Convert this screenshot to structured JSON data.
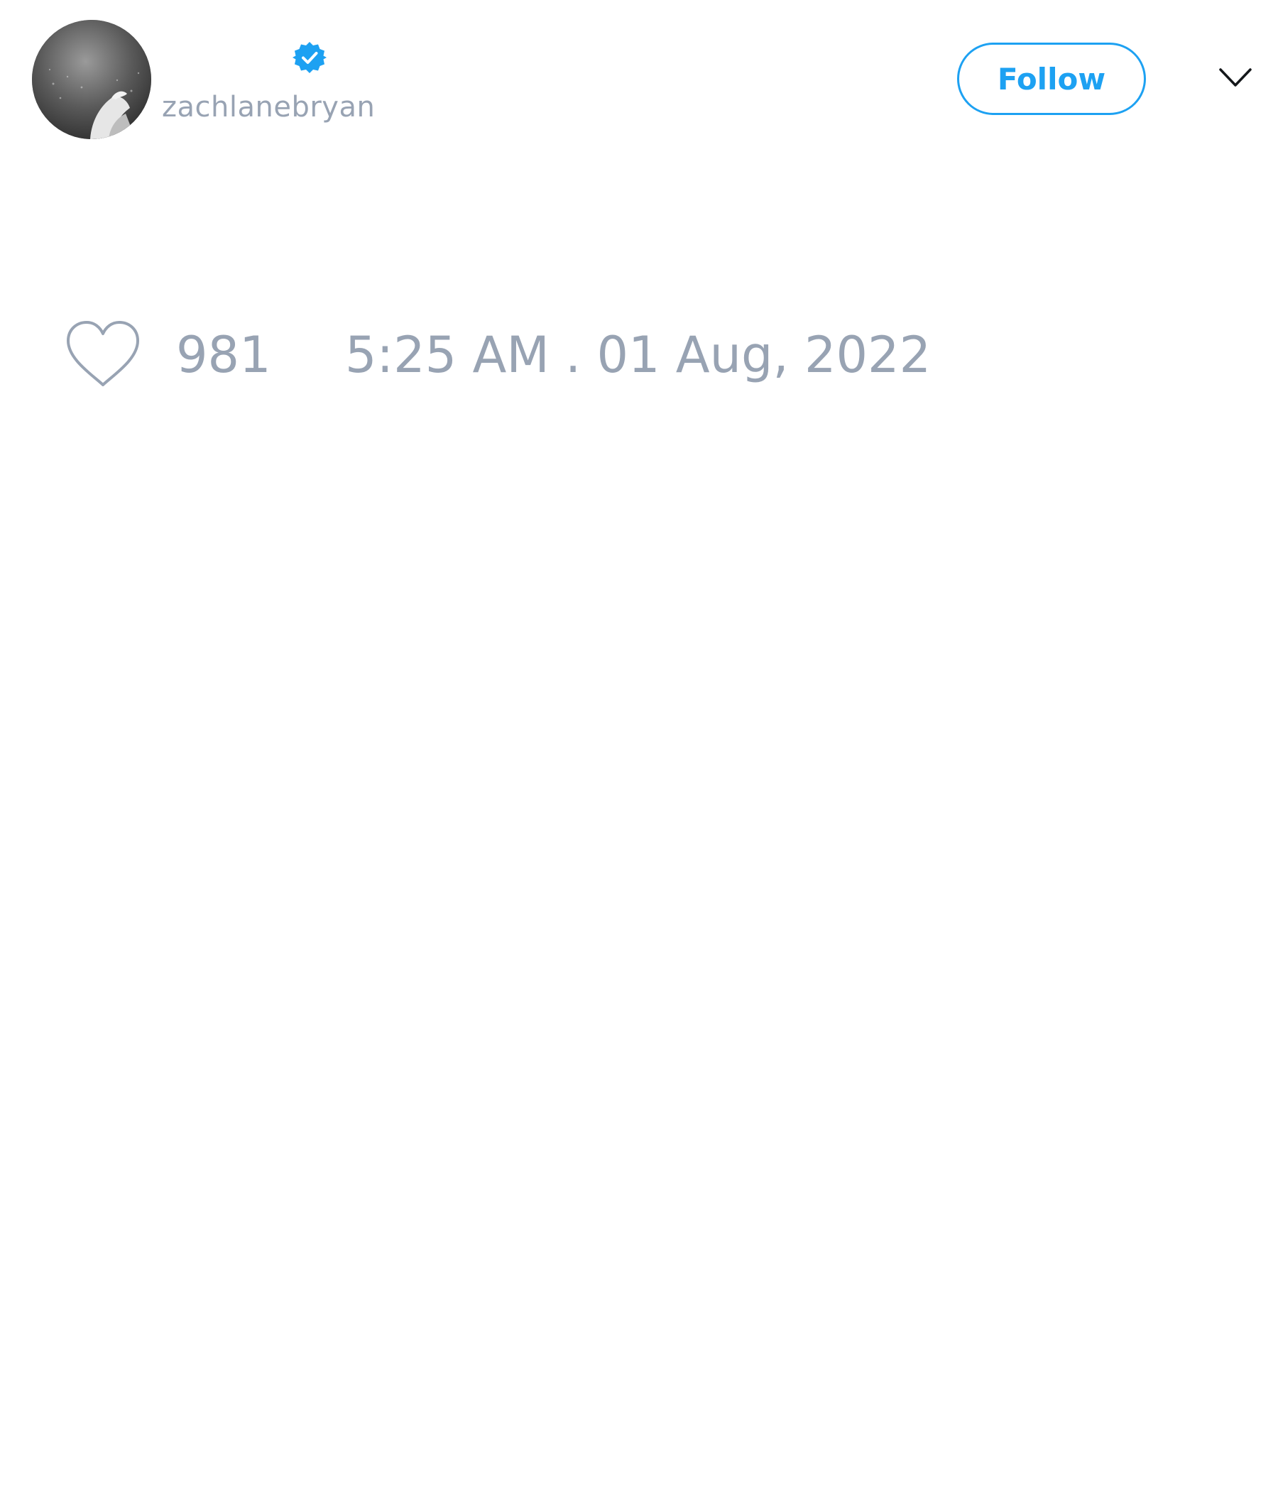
{
  "tweet": {
    "author": {
      "display_name": "",
      "handle": "zachlanebryan",
      "verified": true,
      "avatar_icon": "avatar-photo"
    },
    "follow_button_label": "Follow",
    "menu_icon": "chevron-down-icon",
    "likes": {
      "icon": "heart-icon",
      "count": "981"
    },
    "timestamp": "5:25 AM . 01 Aug, 2022"
  },
  "colors": {
    "accent": "#1da1f2",
    "muted_text": "#98a3b3",
    "background": "#ffffff"
  }
}
